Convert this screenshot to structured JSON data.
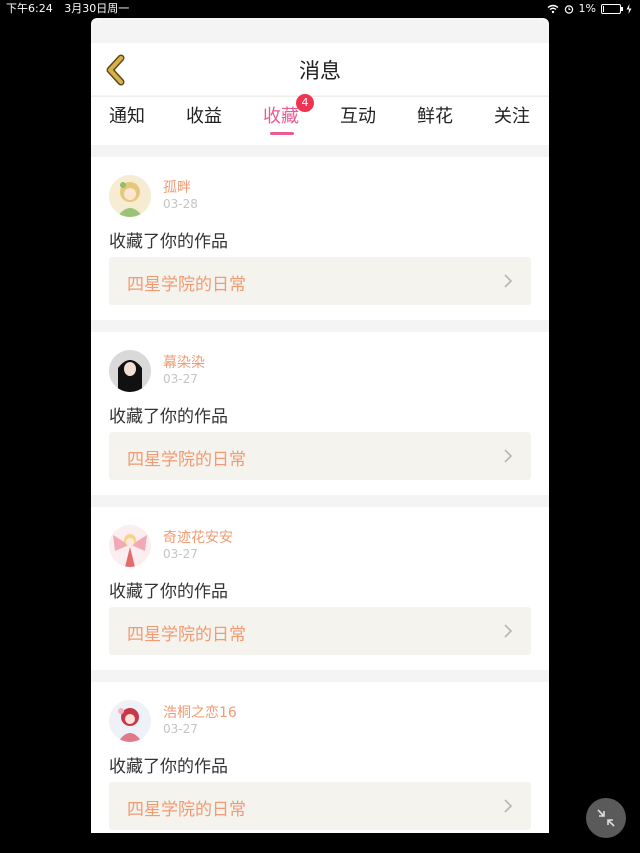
{
  "status_bar": {
    "time": "下午6:24",
    "date": "3月30日周一",
    "battery_text": "1%"
  },
  "header": {
    "title": "消息"
  },
  "tabs": [
    {
      "label": "通知"
    },
    {
      "label": "收益"
    },
    {
      "label": "收藏",
      "active": true,
      "badge": "4"
    },
    {
      "label": "互动"
    },
    {
      "label": "鲜花"
    },
    {
      "label": "关注"
    }
  ],
  "notifications": [
    {
      "username": "孤畔",
      "date": "03-28",
      "message": "收藏了你的作品",
      "work_title": "四星学院的日常"
    },
    {
      "username": "幕染染",
      "date": "03-27",
      "message": "收藏了你的作品",
      "work_title": "四星学院的日常"
    },
    {
      "username": "奇迹花安安",
      "date": "03-27",
      "message": "收藏了你的作品",
      "work_title": "四星学院的日常"
    },
    {
      "username": "浩桐之恋16",
      "date": "03-27",
      "message": "收藏了你的作品",
      "work_title": "四星学院的日常"
    }
  ],
  "colors": {
    "accent": "#ec5a93",
    "username": "#f29a72",
    "badge": "#f0334f",
    "back_arrow": "#d8b04a"
  }
}
